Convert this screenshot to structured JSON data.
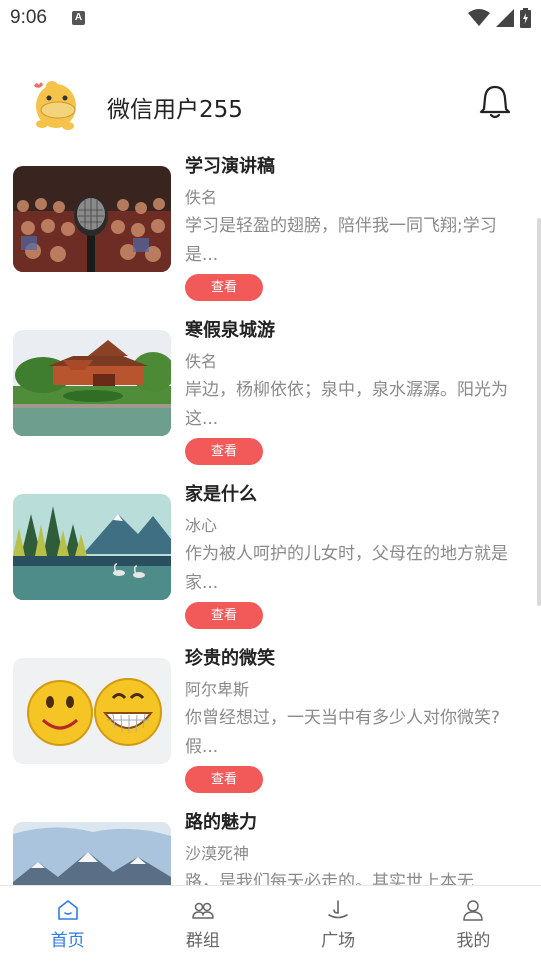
{
  "status_bar": {
    "time": "9:06",
    "notification_letter": "A"
  },
  "header": {
    "username": "微信用户255"
  },
  "articles": [
    {
      "title": "学习演讲稿",
      "author": "佚名",
      "excerpt": "学习是轻盈的翅膀，陪伴我一同飞翔;学习是...",
      "button": "查看",
      "image": "microphone-audience-image"
    },
    {
      "title": "寒假泉城游",
      "author": "佚名",
      "excerpt": "岸边，杨柳依依；泉中，泉水潺潺。阳光为这...",
      "button": "查看",
      "image": "pavilion-lake-image"
    },
    {
      "title": "家是什么",
      "author": "冰心",
      "excerpt": "作为被人呵护的儿女时，父母在的地方就是家...",
      "button": "查看",
      "image": "forest-lake-swans-image"
    },
    {
      "title": "珍贵的微笑",
      "author": "阿尔卑斯",
      "excerpt": "你曾经想过，一天当中有多少人对你微笑?假...",
      "button": "查看",
      "image": "smiley-faces-image"
    },
    {
      "title": "路的魅力",
      "author": "沙漠死神",
      "excerpt": "路，是我们每天必走的。其实世上本无",
      "button": "查看",
      "image": "snowy-mountains-image"
    }
  ],
  "bottom_nav": [
    {
      "label": "首页",
      "icon": "home-icon",
      "active": true
    },
    {
      "label": "群组",
      "icon": "group-icon",
      "active": false
    },
    {
      "label": "广场",
      "icon": "square-icon",
      "active": false
    },
    {
      "label": "我的",
      "icon": "profile-icon",
      "active": false
    }
  ],
  "colors": {
    "accent": "#2f7be8",
    "button": "#f25a5a",
    "muted_text": "#8a8a8a"
  }
}
